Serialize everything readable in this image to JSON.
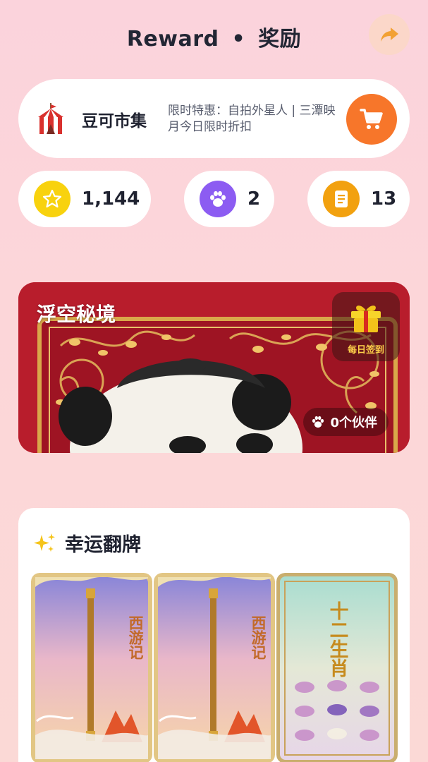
{
  "header": {
    "title_en": "Reward",
    "separator": "•",
    "title_cn": "奖励",
    "share_icon": "share-arrow-icon"
  },
  "market": {
    "name": "豆可市集",
    "promo": "限时特惠：自拍外星人 | 三潭映月今日限时折扣",
    "icon": "circus-tent-icon",
    "cart_icon": "shopping-cart-icon"
  },
  "stats": [
    {
      "icon": "star-icon",
      "value": "1,144",
      "color": "#f8d20e"
    },
    {
      "icon": "paw-icon",
      "value": "2",
      "color": "#8c5cf2"
    },
    {
      "icon": "book-icon",
      "value": "13",
      "color": "#f2a10f"
    }
  ],
  "banner": {
    "title": "浮空秘境",
    "checkin_label": "每日签到",
    "partner_label": "0个伙伴"
  },
  "lucky": {
    "title": "幸运翻牌",
    "cards": [
      {
        "title": "西游记"
      },
      {
        "title": "西游记"
      },
      {
        "title": "十二生肖"
      }
    ]
  }
}
